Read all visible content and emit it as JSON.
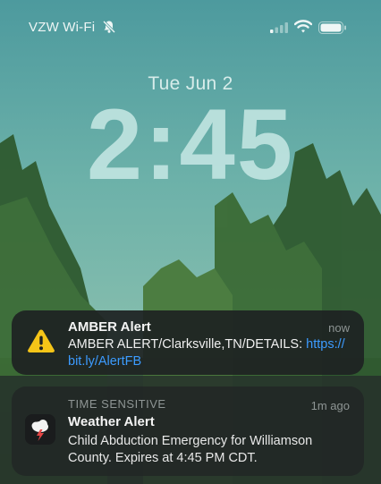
{
  "status_bar": {
    "carrier": "VZW Wi-Fi"
  },
  "lock_screen": {
    "date": "Tue Jun 2",
    "time": "2:45"
  },
  "notifications": [
    {
      "title": "AMBER Alert",
      "time": "now",
      "body_text": "AMBER ALERT/Clarksville,TN/DETAILS: ",
      "link_part1": "https://",
      "link_part2": "bit.ly/AlertFB",
      "icon": "warning-icon"
    },
    {
      "label": "TIME SENSITIVE",
      "title": "Weather Alert",
      "time": "1m ago",
      "body_line1": "Child Abduction Emergency for Williamson",
      "body_line2": "County. Expires at 4:45 PM CDT.",
      "icon": "weather-app-icon"
    }
  ],
  "colors": {
    "link": "#3c9bff",
    "warning": "#f5c518"
  }
}
